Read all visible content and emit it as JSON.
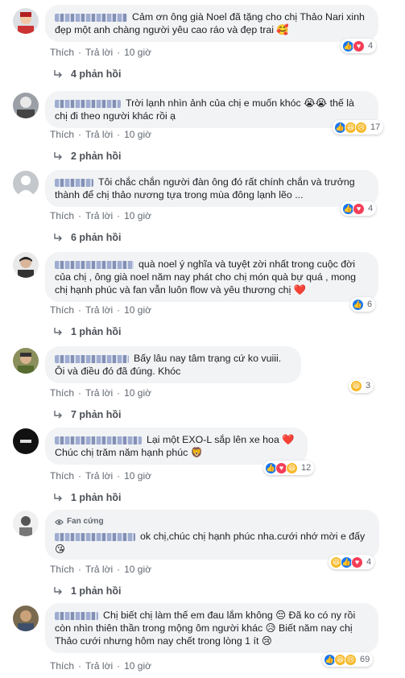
{
  "actions": {
    "like": "Thích",
    "reply": "Trả lời",
    "sep": "·"
  },
  "comments": [
    {
      "text": "Cảm ơn ông già Noel đã tặng cho chị Thảo Nari xinh đẹp một anh chàng người yêu cao ráo và đẹp trai 🥰",
      "time": "10 giờ",
      "reactions": [
        "like",
        "love"
      ],
      "reaction_count": "4",
      "replies": "4 phản hồi"
    },
    {
      "text": "Trời lạnh nhìn ảnh của chị e muốn khóc 😭😭 thế là chị đi theo người khác rồi ạ",
      "time": "10 giờ",
      "reactions": [
        "like",
        "haha",
        "sad"
      ],
      "reaction_count": "17",
      "replies": "2 phản hồi"
    },
    {
      "text": "Tôi chắc chắn người đàn ông đó rất chính chắn và trưởng thành để chị thảo nương tựa trong mùa đông lạnh lẽo ...",
      "time": "10 giờ",
      "reactions": [
        "like",
        "love"
      ],
      "reaction_count": "4",
      "replies": "6 phản hồi"
    },
    {
      "text": "quà noel ý nghĩa và tuyệt zời nhất trong cuộc đời của chị , ông già noel năm nay phát cho chị món quà bự quá , mong chị hạnh phúc và fan vẫn luôn flow và yêu thương chị ❤️",
      "time": "10 giờ",
      "reactions": [
        "like"
      ],
      "reaction_count": "6",
      "replies": "1 phản hồi"
    },
    {
      "text": "Bấy lâu nay tâm trạng cứ ko vuiii. Ôi và điều đó đã đúng. Khóc",
      "time": "10 giờ",
      "reactions": [
        "haha"
      ],
      "reaction_count": "3",
      "replies": "7 phản hồi"
    },
    {
      "text": "Lại một EXO-L sắp lên xe hoa ❤️ Chúc chị trăm năm hạnh phúc 🦁",
      "time": "10 giờ",
      "reactions": [
        "like",
        "love",
        "haha"
      ],
      "reaction_count": "12",
      "replies": "1 phản hồi"
    },
    {
      "badge": "Fan cứng",
      "text": "ok chị,chúc chị hạnh phúc nha.cưới nhớ mời e đấy😘",
      "time": "10 giờ",
      "reactions": [
        "haha",
        "like",
        "love"
      ],
      "reaction_count": "4",
      "replies": "1 phản hồi"
    },
    {
      "text": "Chị biết chị làm thế em đau lắm không 😔 Đã ko có ny rồi còn nhìn thiên thần trong mộng ôm người khác 😥 Biết năm nay chị Thảo cưới nhưng hôm nay chết trong lòng 1 ít 😢",
      "time": "10 giờ",
      "reactions": [
        "like",
        "haha",
        "sad"
      ],
      "reaction_count": "69"
    }
  ]
}
